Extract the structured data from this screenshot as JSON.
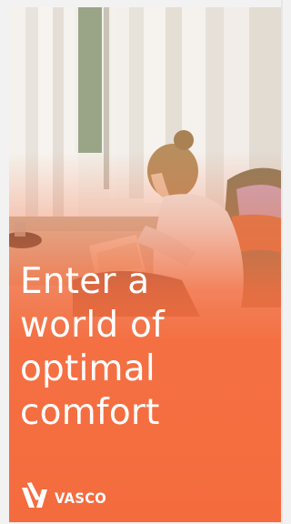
{
  "hero": {
    "headline_lines": [
      "Enter a",
      "world of",
      "optimal",
      "comfort"
    ],
    "image_alt": "woman-reading-by-window-photo"
  },
  "brand": {
    "name": "VASCO",
    "logo_icon": "vasco-logo-icon"
  },
  "colors": {
    "accent": "#f46c3e",
    "text": "#ffffff"
  }
}
